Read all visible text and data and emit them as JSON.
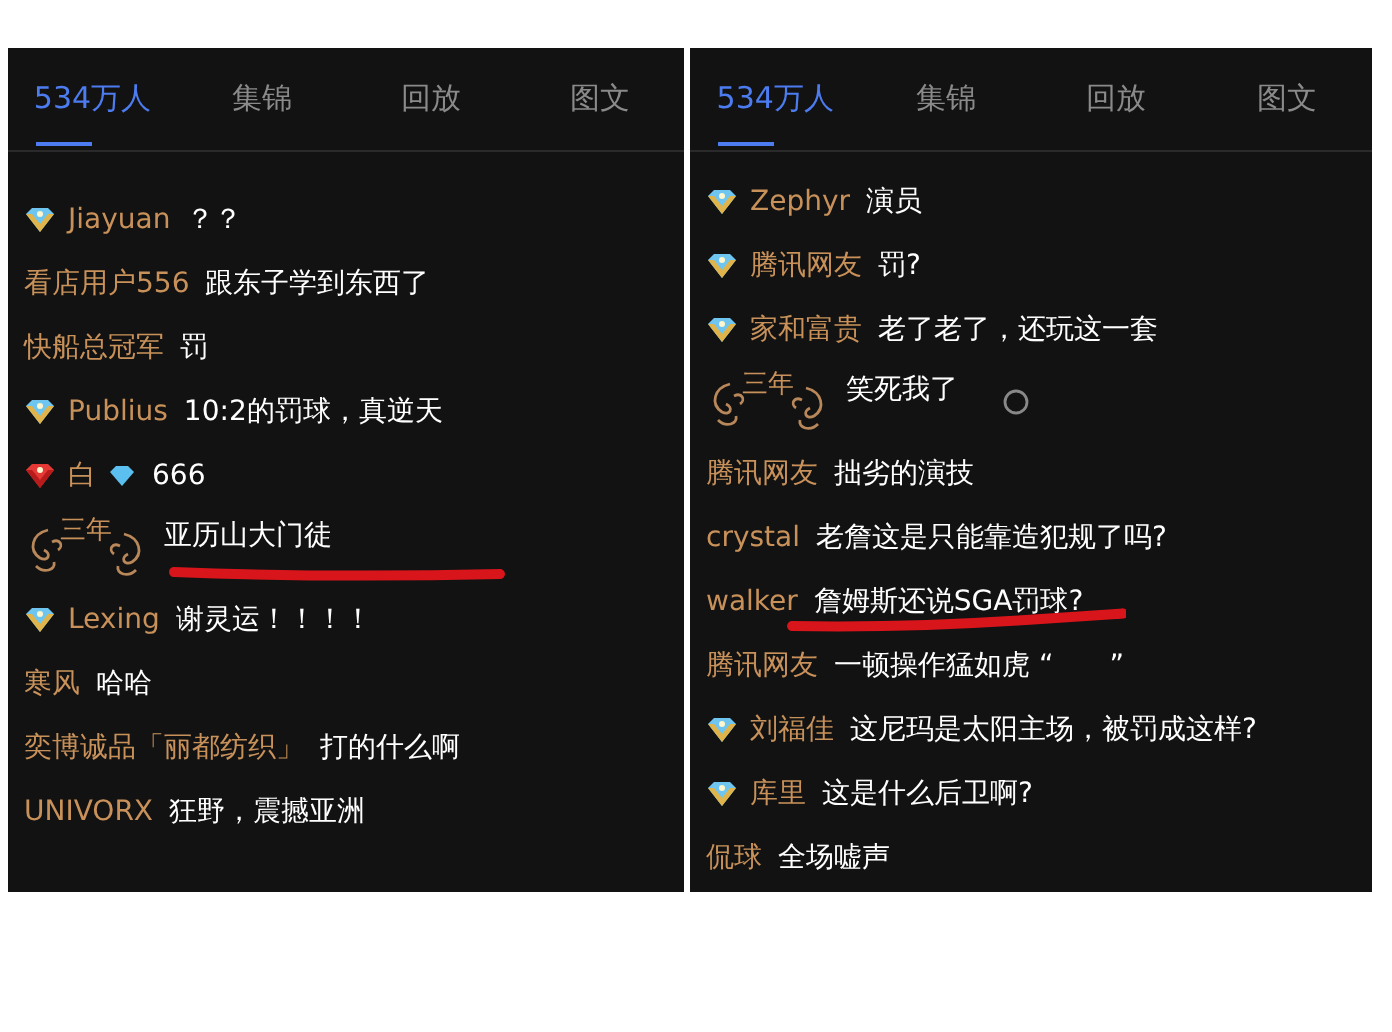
{
  "panels": [
    {
      "tabs": [
        {
          "label": "534万人",
          "selected": true
        },
        {
          "label": "集锦",
          "selected": false
        },
        {
          "label": "回放",
          "selected": false
        },
        {
          "label": "图文",
          "selected": false
        }
      ],
      "messages": [
        {
          "kind": "diamond",
          "name": "Jiayuan",
          "text": "？？"
        },
        {
          "kind": "plain",
          "name": "看店用户556",
          "text": "跟东子学到东西了"
        },
        {
          "kind": "plain",
          "name": "快船总冠军",
          "text": "罚"
        },
        {
          "kind": "diamond",
          "name": "Publius",
          "text": "10:2的罚球，真逆天"
        },
        {
          "kind": "red",
          "name": "白",
          "name_gem": true,
          "text": "666"
        },
        {
          "kind": "ornament",
          "badge_text": "三年",
          "text": "亚历山大门徒",
          "underlined": true
        },
        {
          "kind": "diamond",
          "name": "Lexing",
          "text": "谢灵运！！！！"
        },
        {
          "kind": "plain",
          "name": "寒风",
          "text": "哈哈"
        },
        {
          "kind": "plain",
          "name": "奕博诚品「丽都纺织」",
          "text": "打的什么啊"
        },
        {
          "kind": "plain",
          "name": "UNIVORX",
          "text": "狂野，震撼亚洲"
        }
      ]
    },
    {
      "tabs": [
        {
          "label": "534万人",
          "selected": true
        },
        {
          "label": "集锦",
          "selected": false
        },
        {
          "label": "回放",
          "selected": false
        },
        {
          "label": "图文",
          "selected": false
        }
      ],
      "messages": [
        {
          "kind": "diamond",
          "name": "Zephyr",
          "text": "演员"
        },
        {
          "kind": "diamond",
          "name": "腾讯网友",
          "text": "罚?"
        },
        {
          "kind": "diamond",
          "name": "家和富贵",
          "text": "老了老了，还玩这一套"
        },
        {
          "kind": "ornament",
          "badge_text": "三年",
          "text": "笑死我了",
          "circle": true
        },
        {
          "kind": "plain",
          "name": "腾讯网友",
          "text": "拙劣的演技"
        },
        {
          "kind": "plain",
          "name": "crystal",
          "text": "老詹这是只能靠造犯规了吗?"
        },
        {
          "kind": "plain",
          "name": "walker",
          "text": "詹姆斯还说SGA罚球?",
          "underlined": true
        },
        {
          "kind": "plain",
          "name": "腾讯网友",
          "text": "一顿操作猛如虎 “　　”"
        },
        {
          "kind": "diamond",
          "name": "刘福佳",
          "text": "这尼玛是太阳主场，被罚成这样?"
        },
        {
          "kind": "diamond",
          "name": "库里",
          "text": "这是什么后卫啊?"
        },
        {
          "kind": "plain",
          "name": "侃球",
          "text": "全场嘘声"
        }
      ]
    }
  ]
}
